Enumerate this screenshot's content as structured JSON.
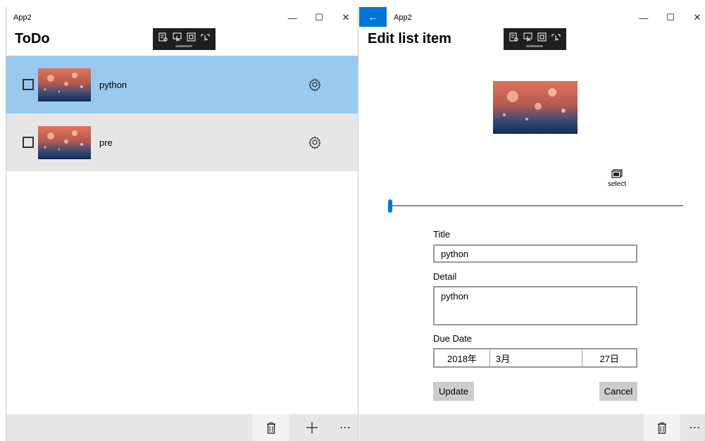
{
  "left_window": {
    "app_title": "App2",
    "heading": "ToDo",
    "items": [
      {
        "label": "python",
        "checked": false,
        "selected": true
      },
      {
        "label": "pre",
        "checked": false,
        "selected": false
      }
    ],
    "appbar": {
      "delete_icon": "trash-icon",
      "add_icon": "plus-icon",
      "more_label": "⋯"
    }
  },
  "right_window": {
    "app_title": "App2",
    "heading": "Edit list item",
    "select_label": "select",
    "form": {
      "title_label": "Title",
      "title_value": "python",
      "detail_label": "Detail",
      "detail_value": "python",
      "due_date_label": "Due Date",
      "year": "2018年",
      "month": "3月",
      "day": "27日"
    },
    "update_label": "Update",
    "cancel_label": "Cancel",
    "appbar": {
      "delete_icon": "trash-icon",
      "more_label": "⋯"
    }
  },
  "caption": {
    "minimize": "—",
    "maximize": "☐",
    "close": "✕",
    "back": "←"
  },
  "colors": {
    "accent": "#0078d7",
    "selected_row": "#99c9ef",
    "alt_row": "#e6e6e6",
    "appbar": "#e6e6e6",
    "devtools": "#1f1f1f"
  }
}
